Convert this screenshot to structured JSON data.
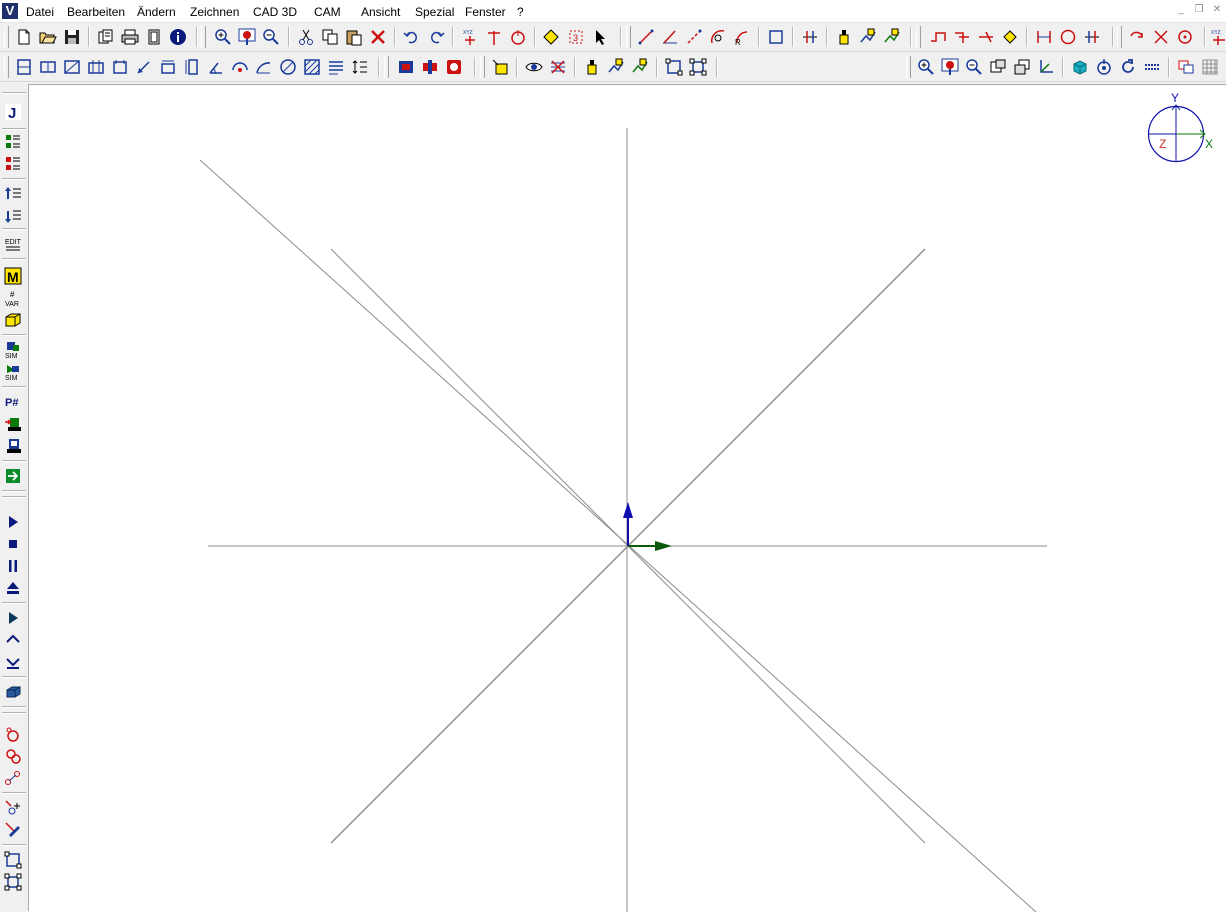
{
  "app": {
    "icon_letter": "V"
  },
  "menu": {
    "items": [
      "Datei",
      "Bearbeiten",
      "Ändern",
      "Zeichnen",
      "CAD 3D",
      "CAM",
      "Ansicht",
      "Spezial",
      "Fenster",
      "?"
    ]
  },
  "window_controls": {
    "minimize": "_",
    "restore": "❐",
    "close": "✕"
  },
  "toolbar1": {
    "tail_label": "XYZ"
  },
  "orientation_widget": {
    "y_label": "Y",
    "x_label": "X",
    "z_label": "Z"
  },
  "colors": {
    "blue_axis": "#1010b0",
    "green_axis": "#0a5a0a",
    "red_z": "#d03030",
    "geometry_line": "#8c8c8c",
    "icon_blue": "#1a3a9a",
    "icon_red": "#cc1111",
    "icon_yellow": "#ffe600"
  }
}
